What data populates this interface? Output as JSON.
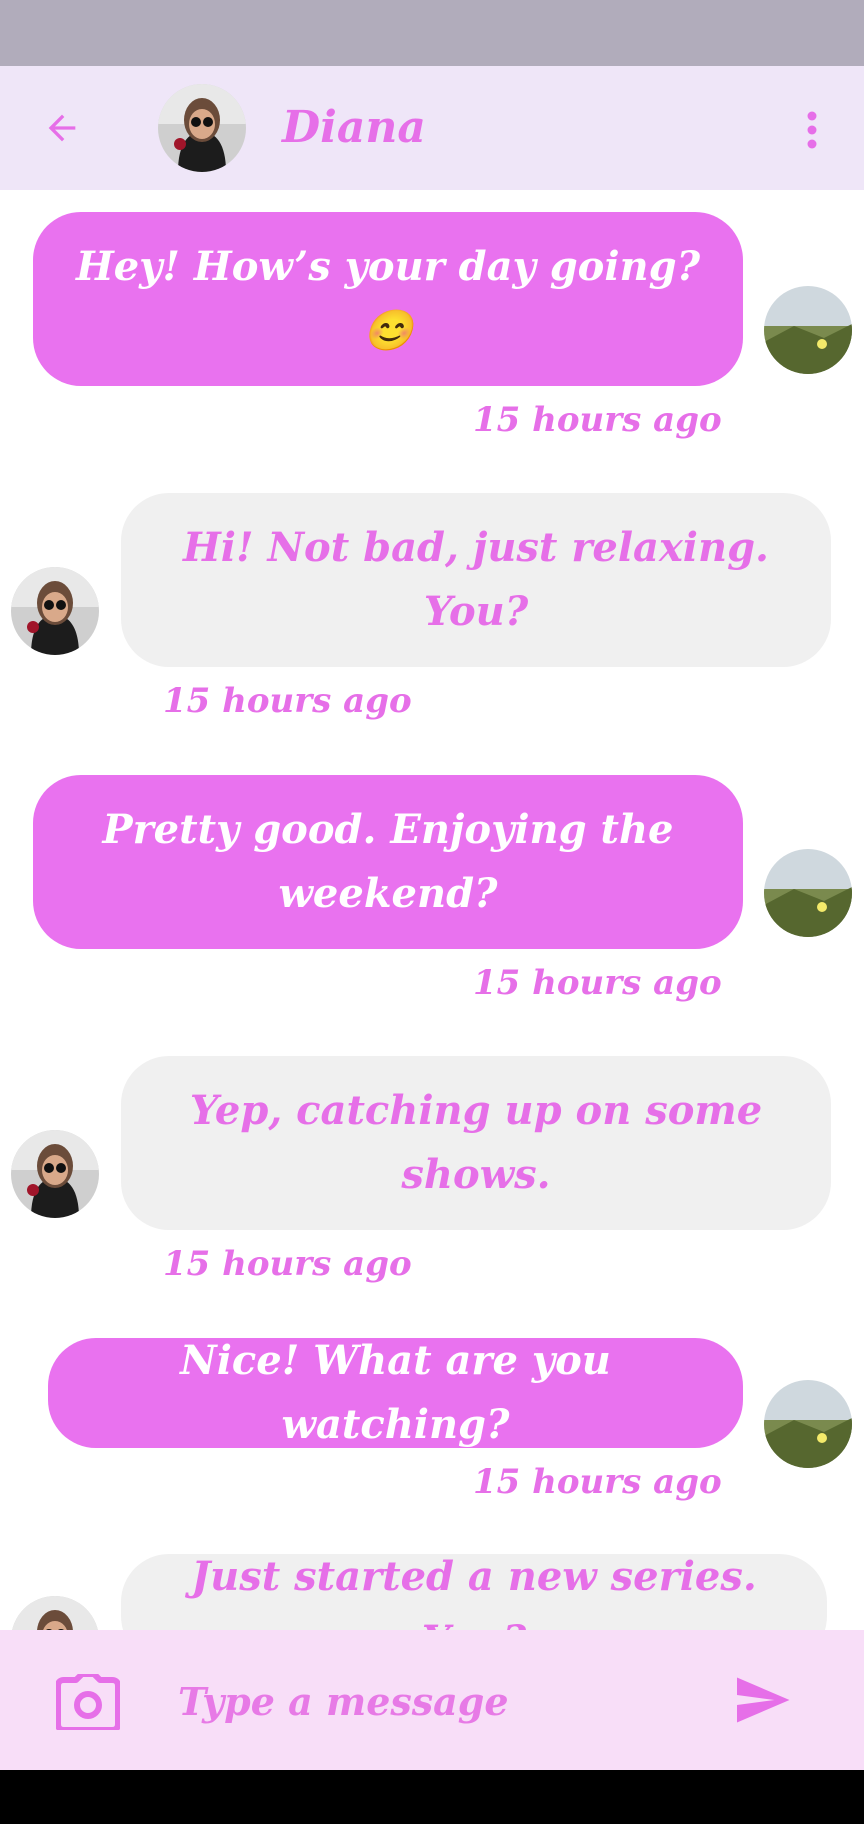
{
  "header": {
    "contact_name": "Diana"
  },
  "messages": [
    {
      "type": "sent",
      "text": "Hey! How’s your day going? 😊",
      "time": "15 hours ago"
    },
    {
      "type": "recv",
      "text": "Hi! Not bad, just relaxing. You?",
      "time": "15 hours ago"
    },
    {
      "type": "sent",
      "text": "Pretty good. Enjoying the weekend?",
      "time": "15 hours ago"
    },
    {
      "type": "recv",
      "text": "Yep, catching up on some shows.",
      "time": "15 hours ago"
    },
    {
      "type": "sent",
      "text": "Nice! What are you watching?",
      "time": "15 hours ago"
    },
    {
      "type": "recv",
      "text": "Just started a new series. You?",
      "time": ""
    }
  ],
  "input": {
    "placeholder": "Type a message"
  },
  "colors": {
    "accent": "#e66fe8",
    "sent_bubble": "#e972ef",
    "recv_bubble": "#f0f0f0",
    "header_bg": "#efe6f8",
    "input_bg": "#f8def8"
  },
  "icons": {
    "back": "arrow-left-icon",
    "menu": "more-vertical-icon",
    "camera": "camera-icon",
    "send": "send-icon"
  }
}
